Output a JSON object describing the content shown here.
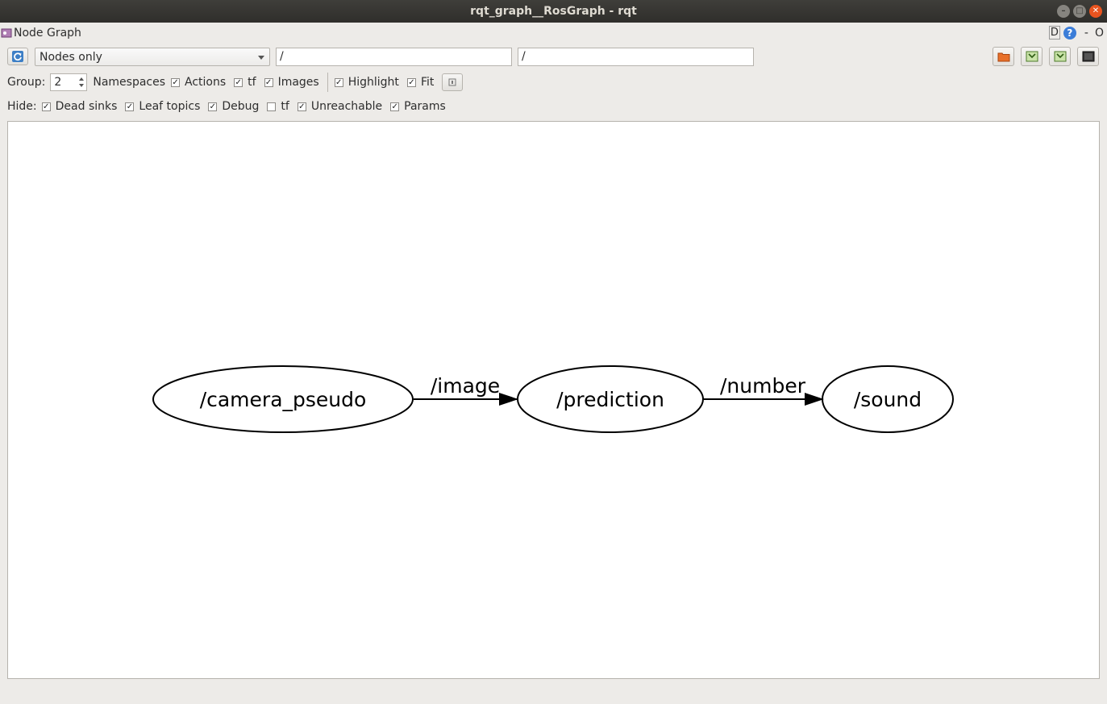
{
  "window": {
    "title": "rqt_graph__RosGraph - rqt"
  },
  "plugin": {
    "title": "Node Graph",
    "right_d": "D",
    "right_help": "?",
    "right_dash": "-",
    "right_o": "O"
  },
  "toolbar": {
    "filter_mode": "Nodes only",
    "node_filter": "/",
    "topic_filter": "/"
  },
  "options": {
    "group_label": "Group:",
    "group_value": "2",
    "namespaces": "Namespaces",
    "actions": "Actions",
    "tf": "tf",
    "images": "Images",
    "highlight": "Highlight",
    "fit": "Fit"
  },
  "hide": {
    "label": "Hide:",
    "dead_sinks": "Dead sinks",
    "leaf_topics": "Leaf topics",
    "debug": "Debug",
    "tf": "tf",
    "unreachable": "Unreachable",
    "params": "Params"
  },
  "graph": {
    "nodes": [
      "/camera_pseudo",
      "/prediction",
      "/sound"
    ],
    "edges": [
      {
        "from": "/camera_pseudo",
        "to": "/prediction",
        "label": "/image"
      },
      {
        "from": "/prediction",
        "to": "/sound",
        "label": "/number"
      }
    ]
  }
}
